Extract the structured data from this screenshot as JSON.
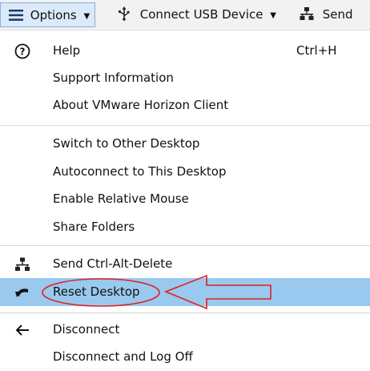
{
  "toolbar": {
    "options_label": "Options",
    "connect_usb_label": "Connect USB Device",
    "send_label": "Send"
  },
  "menu": {
    "items": [
      {
        "label": "Help",
        "shortcut": "Ctrl+H",
        "icon": "help-circle-icon"
      },
      {
        "label": "Support Information"
      },
      {
        "label": "About VMware Horizon Client"
      },
      {
        "label": "Switch to Other Desktop"
      },
      {
        "label": "Autoconnect to This Desktop"
      },
      {
        "label": "Enable Relative Mouse"
      },
      {
        "label": "Share Folders"
      },
      {
        "label": "Send Ctrl-Alt-Delete",
        "icon": "network-send-icon"
      },
      {
        "label": "Reset Desktop",
        "icon": "reset-arrow-icon",
        "highlighted": true
      },
      {
        "label": "Disconnect",
        "icon": "left-arrow-icon"
      },
      {
        "label": "Disconnect and Log Off"
      }
    ]
  },
  "colors": {
    "highlight": "#99c9ef",
    "annotation": "#e02020",
    "toolbar_active": "#dbe9f8"
  }
}
